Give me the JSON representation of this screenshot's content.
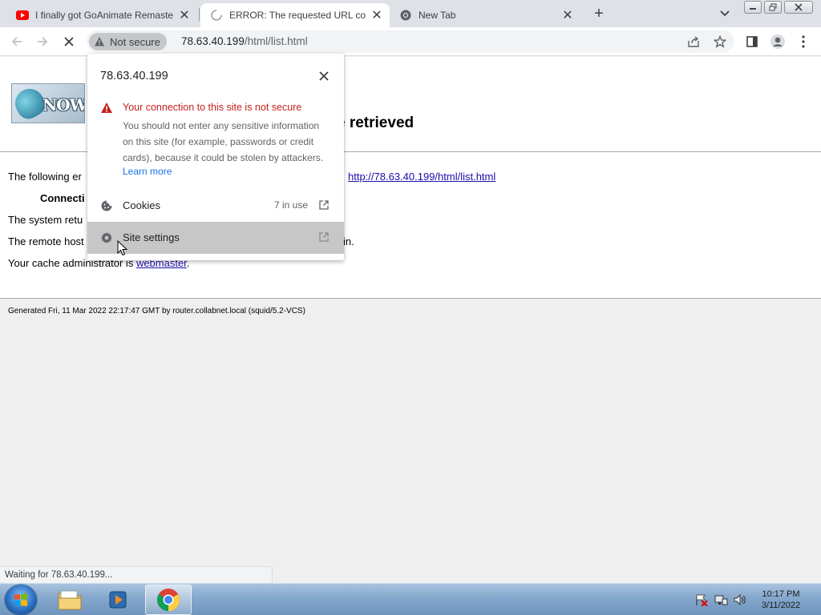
{
  "tabs": [
    {
      "title": "I finally got GoAnimate Remastered",
      "favicon": "youtube-icon"
    },
    {
      "title": "ERROR: The requested URL could not be retrieved",
      "favicon": "loading-spinner-icon"
    },
    {
      "title": "New Tab",
      "favicon": "chrome-icon"
    }
  ],
  "toolbar": {
    "security_chip": "Not secure",
    "url_host": "78.63.40.199",
    "url_path": "/html/list.html"
  },
  "page": {
    "error_title_visible": "e retrieved",
    "line1_prefix": "The following er",
    "line1_link": "http://78.63.40.199/html/list.html",
    "line2_bold": "Connecti",
    "line3": "The system retu",
    "line4_prefix": "The remote host",
    "line4_suffix": "in.",
    "line5_prefix": "Your cache administrator is ",
    "line5_link": "webmaster",
    "line5_suffix": ".",
    "generated": "Generated Fri, 11 Mar 2022 22:17:47 GMT by router.collabnet.local (squid/5.2-VCS)"
  },
  "popup": {
    "host": "78.63.40.199",
    "warning_title": "Your connection to this site is not secure",
    "warning_body": "You should not enter any sensitive information on this site (for example, passwords or credit cards), because it could be stolen by attackers.",
    "learn_more": "Learn more",
    "cookies_label": "Cookies",
    "cookies_count": "7 in use",
    "site_settings_label": "Site settings"
  },
  "status_bar": "Waiting for 78.63.40.199...",
  "taskbar": {
    "time": "10:17 PM",
    "date": "3/11/2022"
  },
  "colors": {
    "warning_red": "#c5221f",
    "link_blue": "#1a73e8",
    "tabstrip": "#dee1e6"
  }
}
